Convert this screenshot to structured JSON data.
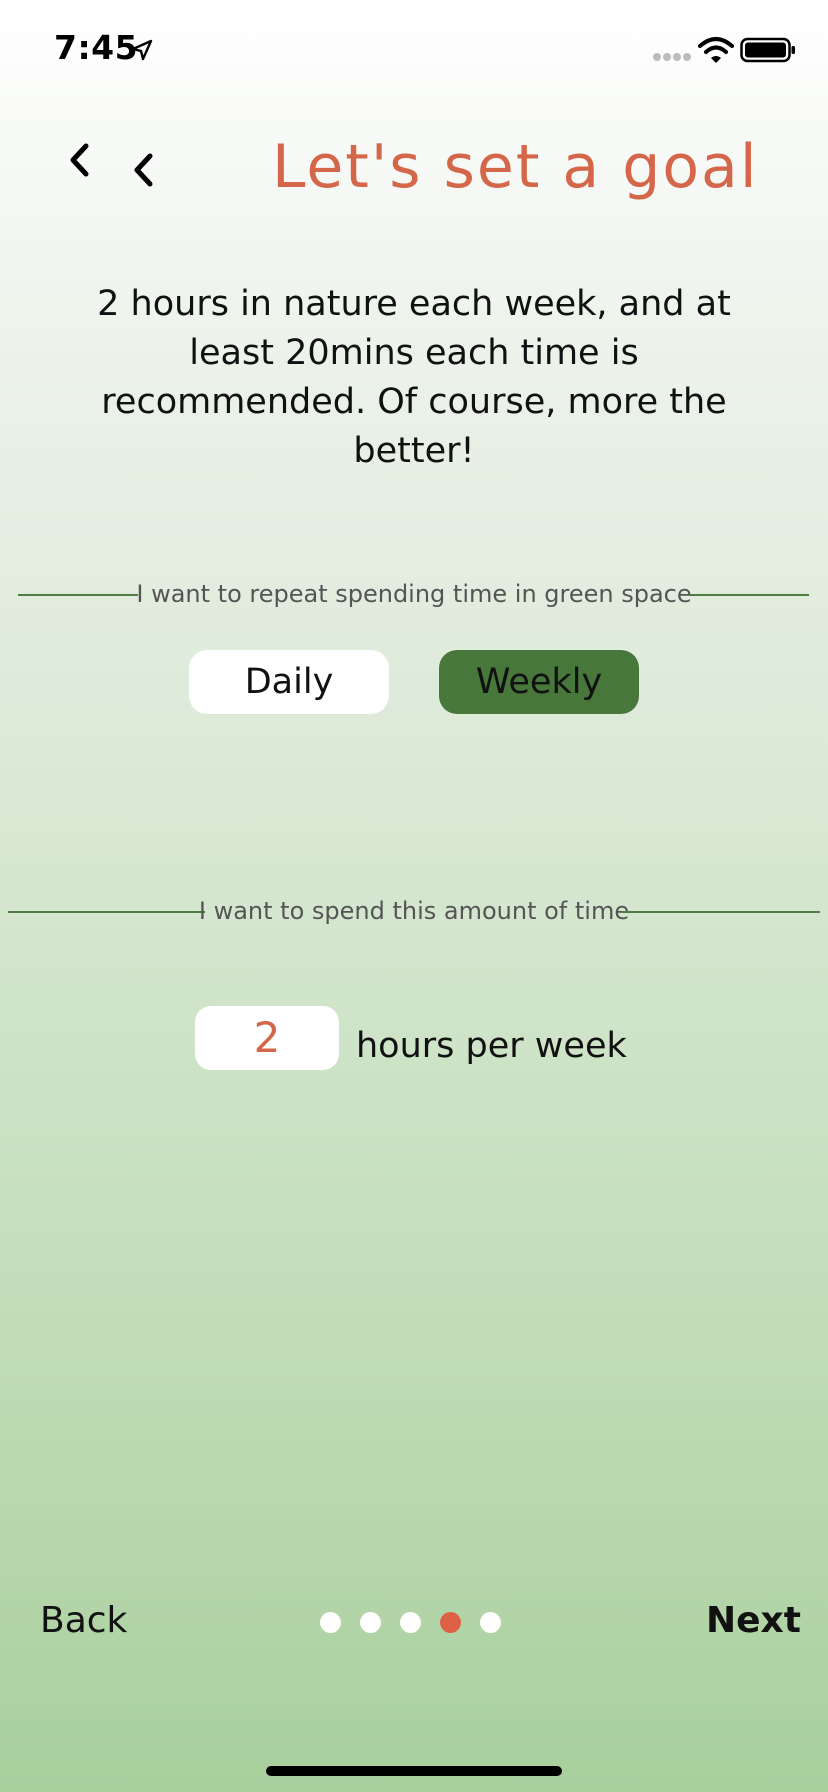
{
  "status_bar": {
    "time": "7:45"
  },
  "header": {
    "title": "Let's set a goal"
  },
  "intro": {
    "text": "2 hours in nature each week, and at least 20mins each time is recommended. Of course, more the better!"
  },
  "frequency": {
    "section_label": "I want to repeat spending time in green space",
    "options": [
      "Daily",
      "Weekly"
    ],
    "selected": "Weekly"
  },
  "amount": {
    "section_label": "I want to spend this amount of time",
    "value": "2",
    "unit_label": "hours per week"
  },
  "footer": {
    "back_label": "Back",
    "next_label": "Next",
    "page_count": 5,
    "current_page": 4
  },
  "colors": {
    "accent": "#d4664a",
    "selected_toggle": "#47773a",
    "divider": "#4f7c42",
    "active_dot": "#de6145"
  }
}
